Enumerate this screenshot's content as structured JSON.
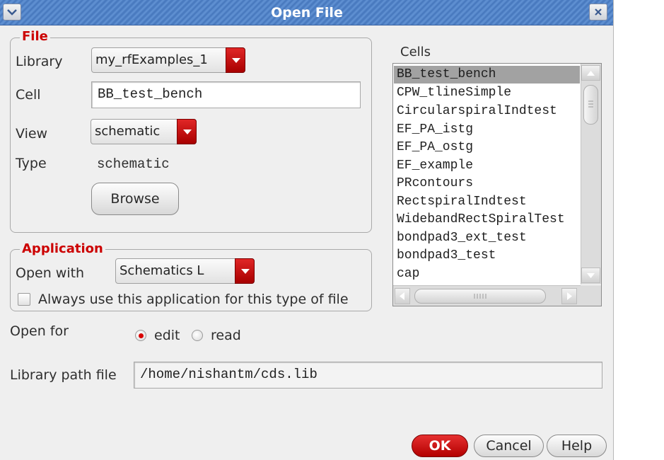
{
  "window": {
    "title": "Open File",
    "menu_icon": "chevron-down",
    "close_icon": "close-x"
  },
  "file_group": {
    "legend": "File",
    "library_label": "Library",
    "library_value": "my_rfExamples_1",
    "cell_label": "Cell",
    "cell_value": "BB_test_bench",
    "view_label": "View",
    "view_value": "schematic",
    "type_label": "Type",
    "type_value": "schematic",
    "browse_label": "Browse"
  },
  "application_group": {
    "legend": "Application",
    "open_with_label": "Open with",
    "open_with_value": "Schematics L",
    "always_use_label": "Always use this application for this type of file",
    "always_use_checked": false
  },
  "open_for": {
    "label": "Open for",
    "options": [
      "edit",
      "read"
    ],
    "selected": "edit"
  },
  "library_path": {
    "label": "Library path file",
    "value": "/home/nishantm/cds.lib"
  },
  "cells": {
    "label": "Cells",
    "items": [
      "BB_test_bench",
      "CPW_tlineSimple",
      "CircularspiralIndtest",
      "EF_PA_istg",
      "EF_PA_ostg",
      "EF_example",
      "PRcontours",
      "RectspiralIndtest",
      "WidebandRectSpiralTest",
      "bondpad3_ext_test",
      "bondpad3_test",
      "cap"
    ],
    "selected_index": 0
  },
  "buttons": {
    "ok": "OK",
    "cancel": "Cancel",
    "help": "Help"
  },
  "colors": {
    "accent_red": "#cc0000",
    "titlebar_blue": "#4a7bc0",
    "selection_gray": "#a2a2a2"
  }
}
